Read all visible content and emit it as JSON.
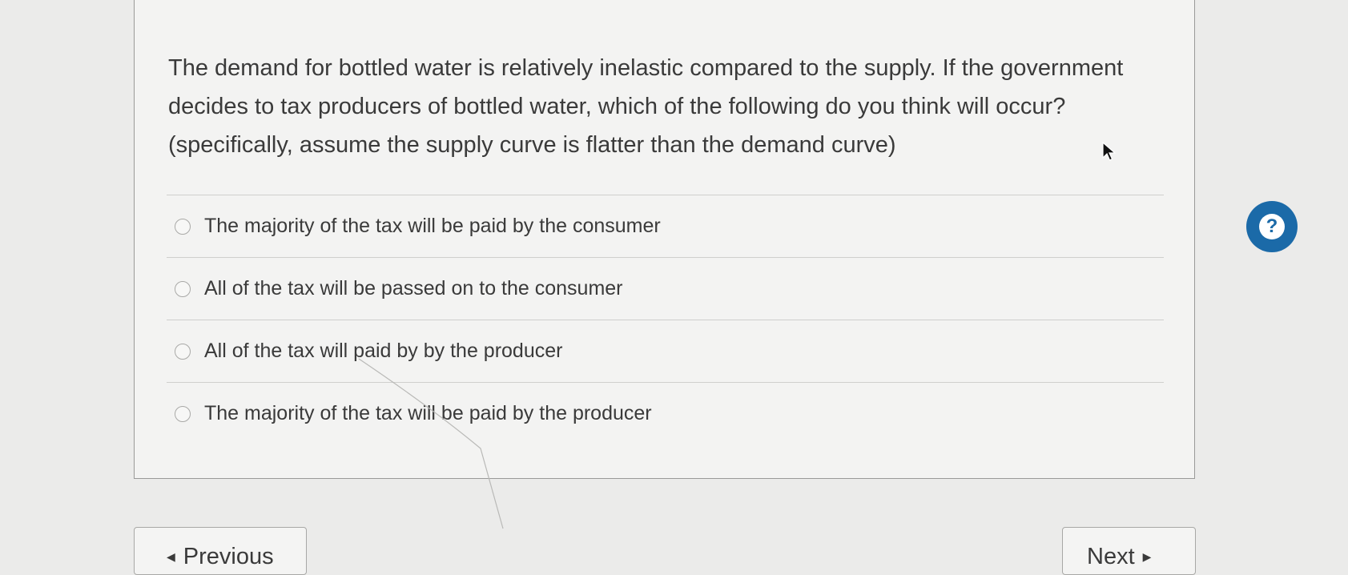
{
  "question": {
    "prompt": "The demand for bottled water is relatively inelastic compared to the supply. If the government decides to tax producers of bottled water, which of the following do you think will occur? (specifically, assume the supply curve is flatter than the demand curve)",
    "options": [
      {
        "label": "The majority of the tax will be paid by the consumer",
        "selected": false
      },
      {
        "label": "All of the tax will be passed on to the consumer",
        "selected": false
      },
      {
        "label": "All of the tax will paid by by the producer",
        "selected": false
      },
      {
        "label": "The majority of the tax will be paid by the producer",
        "selected": false
      }
    ]
  },
  "help": {
    "icon": "question-mark-icon",
    "glyph": "?",
    "color": "#1b6aa8"
  },
  "navigation": {
    "previous_label": "Previous",
    "next_label": "Next",
    "previous_icon": "arrow-left-icon",
    "next_icon": "arrow-right-icon"
  }
}
